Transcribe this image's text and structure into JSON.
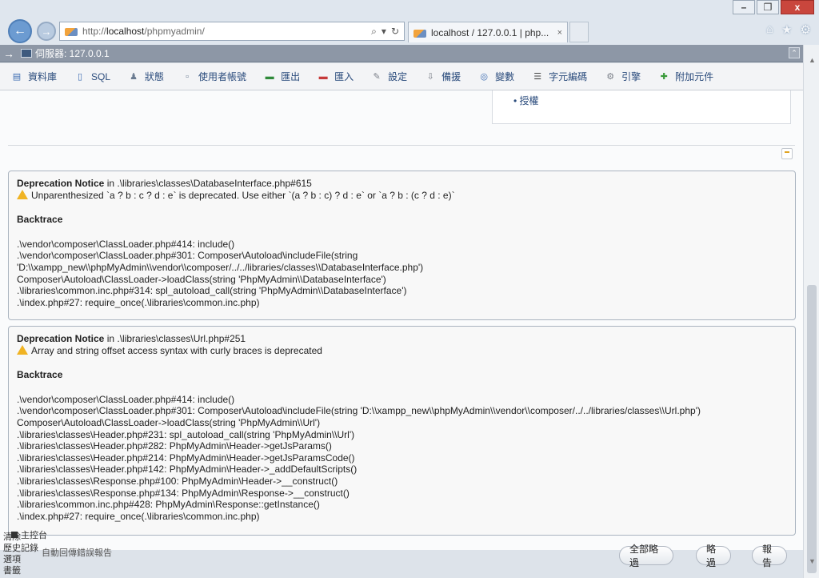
{
  "browser": {
    "url_prefix": "http://",
    "url_host": "localhost",
    "url_path": "/phpmyadmin/",
    "addr_icons": [
      "⌕",
      "▾",
      "↻"
    ],
    "tab_title": "localhost / 127.0.0.1 | php...",
    "tab_close": "×",
    "window_buttons": {
      "minimize": "–",
      "restore": "❐",
      "close": "x"
    },
    "right_icons": [
      "⌂",
      "★",
      "⚙"
    ]
  },
  "topbar": {
    "collapse": "→",
    "server": "伺服器: 127.0.0.1",
    "end": "⌃"
  },
  "menu": [
    {
      "icon": "database-icon",
      "label": "資料庫"
    },
    {
      "icon": "sql-icon",
      "label": "SQL"
    },
    {
      "icon": "status-icon",
      "label": "狀態"
    },
    {
      "icon": "users-icon",
      "label": "使用者帳號"
    },
    {
      "icon": "export-icon",
      "label": "匯出"
    },
    {
      "icon": "import-icon",
      "label": "匯入"
    },
    {
      "icon": "settings-icon",
      "label": "設定"
    },
    {
      "icon": "replication-icon",
      "label": "備援"
    },
    {
      "icon": "variables-icon",
      "label": "變數"
    },
    {
      "icon": "charset-icon",
      "label": "字元編碼"
    },
    {
      "icon": "engines-icon",
      "label": "引擎"
    },
    {
      "icon": "plugins-icon",
      "label": "附加元件"
    }
  ],
  "panel": {
    "bullet": "• 授權"
  },
  "notices": [
    {
      "title_bold": "Deprecation Notice",
      "title_rest": " in .\\libraries\\classes\\DatabaseInterface.php#615",
      "message": "Unparenthesized `a ? b : c ? d : e` is deprecated. Use either `(a ? b : c) ? d : e` or `a ? b : (c ? d : e)`",
      "backtrace_title": "Backtrace",
      "backtrace": [
        ".\\vendor\\composer\\ClassLoader.php#414: include()",
        ".\\vendor\\composer\\ClassLoader.php#301: Composer\\Autoload\\includeFile(string",
        "'D:\\\\xampp_new\\\\phpMyAdmin\\\\vendor\\\\composer/../../libraries/classes\\\\DatabaseInterface.php')",
        "Composer\\Autoload\\ClassLoader->loadClass(string 'PhpMyAdmin\\\\DatabaseInterface')",
        ".\\libraries\\common.inc.php#314: spl_autoload_call(string 'PhpMyAdmin\\\\DatabaseInterface')",
        ".\\index.php#27: require_once(.\\libraries\\common.inc.php)"
      ]
    },
    {
      "title_bold": "Deprecation Notice",
      "title_rest": " in .\\libraries\\classes\\Url.php#251",
      "message": "Array and string offset access syntax with curly braces is deprecated",
      "backtrace_title": "Backtrace",
      "backtrace": [
        ".\\vendor\\composer\\ClassLoader.php#414: include()",
        ".\\vendor\\composer\\ClassLoader.php#301: Composer\\Autoload\\includeFile(string 'D:\\\\xampp_new\\\\phpMyAdmin\\\\vendor\\\\composer/../../libraries/classes\\\\Url.php')",
        "Composer\\Autoload\\ClassLoader->loadClass(string 'PhpMyAdmin\\\\Url')",
        ".\\libraries\\classes\\Header.php#231: spl_autoload_call(string 'PhpMyAdmin\\\\Url')",
        ".\\libraries\\classes\\Header.php#282: PhpMyAdmin\\Header->getJsParams()",
        ".\\libraries\\classes\\Header.php#214: PhpMyAdmin\\Header->getJsParamsCode()",
        ".\\libraries\\classes\\Header.php#142: PhpMyAdmin\\Header->_addDefaultScripts()",
        ".\\libraries\\classes\\Response.php#100: PhpMyAdmin\\Header->__construct()",
        ".\\libraries\\classes\\Response.php#134: PhpMyAdmin\\Response->__construct()",
        ".\\libraries\\common.inc.php#428: PhpMyAdmin\\Response::getInstance()",
        ".\\index.php#27: require_once(.\\libraries\\common.inc.php)"
      ]
    }
  ],
  "footer": {
    "console_label": "主控台",
    "console_side": [
      "清除",
      "歷史記錄",
      "選項",
      "書籤"
    ],
    "autosend": "自動回傳錯誤報告",
    "btn_ignore_all": "全部略過",
    "btn_ignore": "略過",
    "btn_report": "報告"
  }
}
